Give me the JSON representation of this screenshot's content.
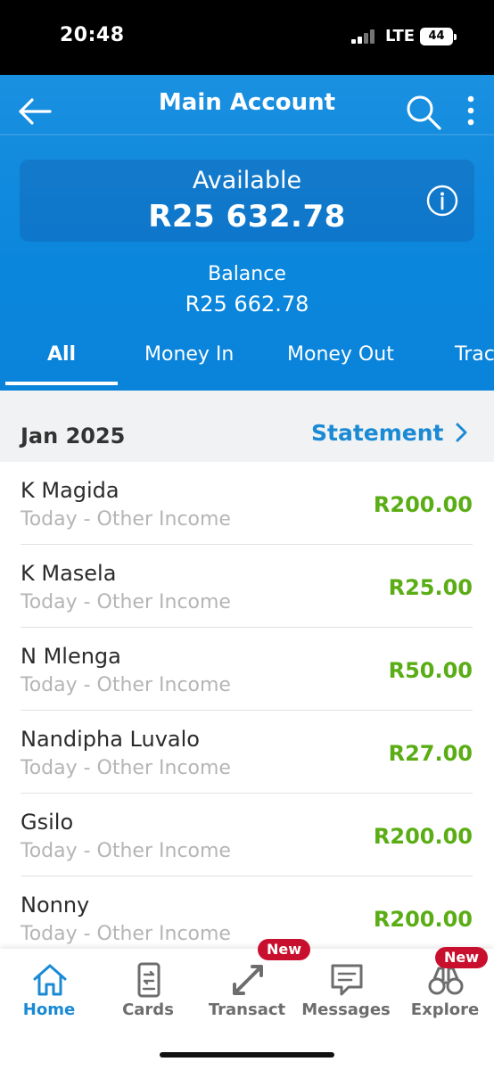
{
  "status_bar": {
    "time": "20:48",
    "network": "LTE",
    "battery": "44"
  },
  "header": {
    "title": "Main Account"
  },
  "available": {
    "label": "Available",
    "amount": "R25 632.78"
  },
  "balance": {
    "label": "Balance",
    "amount": "R25 662.78"
  },
  "tabs": [
    {
      "label": "All",
      "active": true
    },
    {
      "label": "Money In"
    },
    {
      "label": "Money Out"
    },
    {
      "label": "Trac"
    }
  ],
  "month": {
    "label": "Jan 2025",
    "statement_label": "Statement"
  },
  "transactions": [
    {
      "name": "K Magida",
      "desc": "Today - Other Income",
      "amount": "R200.00"
    },
    {
      "name": "K Masela",
      "desc": "Today - Other Income",
      "amount": "R25.00"
    },
    {
      "name": "N Mlenga",
      "desc": "Today - Other Income",
      "amount": "R50.00"
    },
    {
      "name": "Nandipha Luvalo",
      "desc": "Today - Other Income",
      "amount": "R27.00"
    },
    {
      "name": "Gsilo",
      "desc": "Today - Other Income",
      "amount": "R200.00"
    },
    {
      "name": "Nonny",
      "desc": "Today - Other Income",
      "amount": "R200.00"
    }
  ],
  "nav": [
    {
      "label": "Home",
      "icon": "home-icon"
    },
    {
      "label": "Cards",
      "icon": "cards-icon"
    },
    {
      "label": "Transact",
      "icon": "transact-icon",
      "badge": "New"
    },
    {
      "label": "Messages",
      "icon": "messages-icon"
    },
    {
      "label": "Explore",
      "icon": "explore-icon",
      "badge": "New"
    }
  ],
  "colors": {
    "header_blue": "#0a86dc",
    "accent_blue": "#1a8ad4",
    "amount_green": "#5aad14",
    "badge_red": "#c8102e"
  }
}
